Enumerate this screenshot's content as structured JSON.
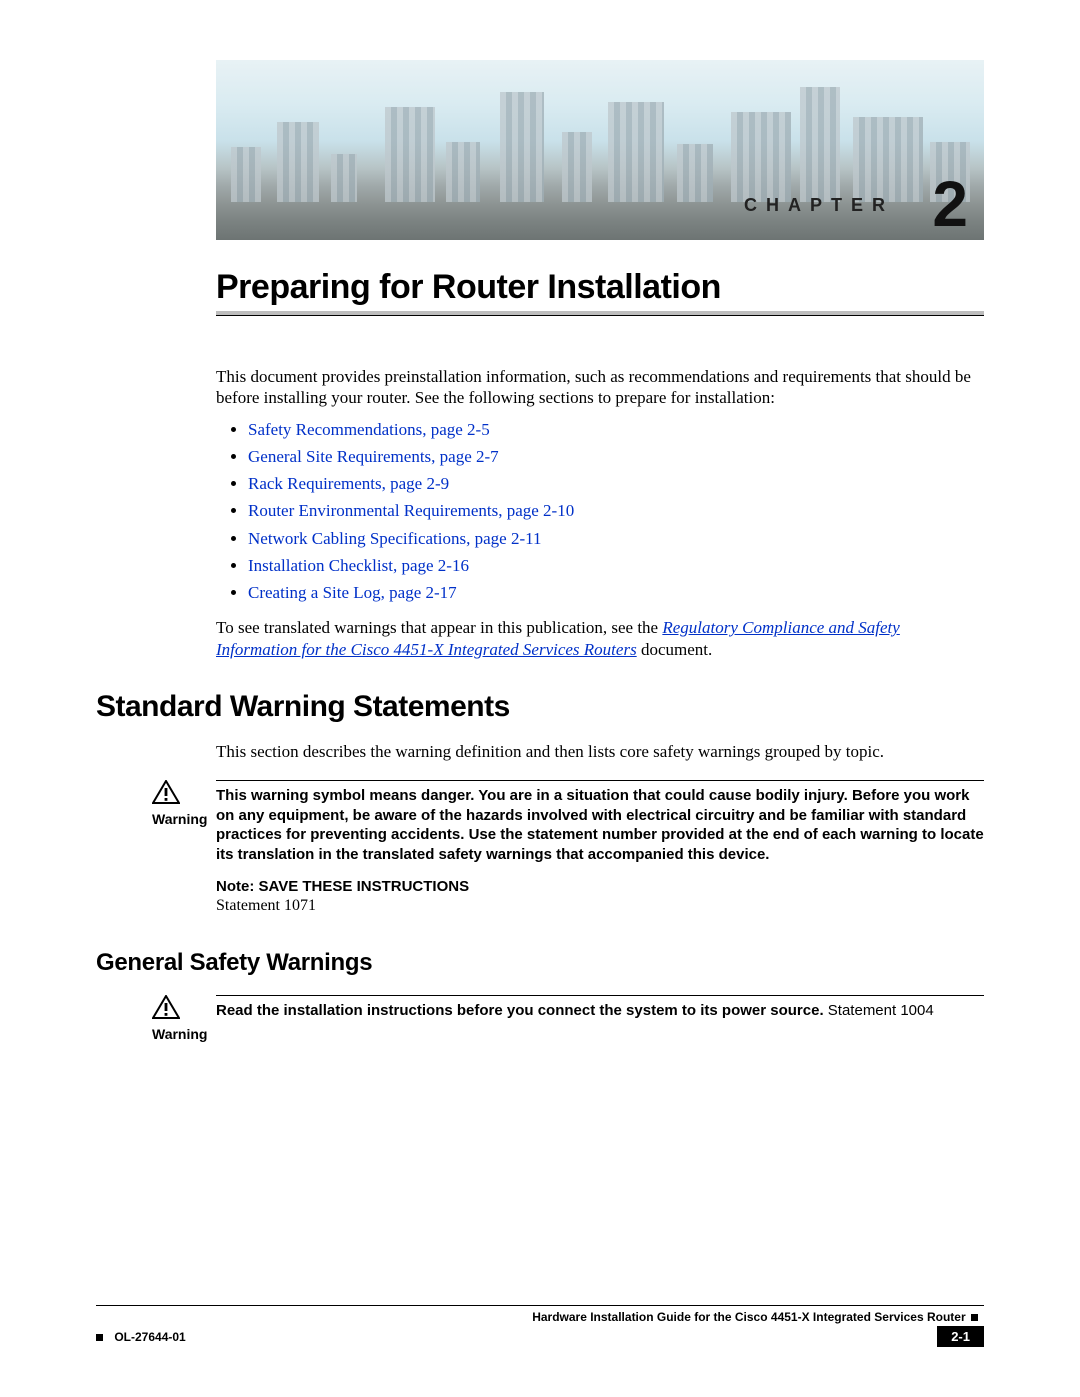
{
  "banner": {
    "chapter_label": "CHAPTER",
    "chapter_number": "2"
  },
  "title": "Preparing for Router Installation",
  "intro": "This document provides preinstallation information, such as recommendations and requirements that should be before installing your router. See the following sections to prepare for installation:",
  "toc": [
    "Safety Recommendations, page 2-5",
    "General Site Requirements, page 2-7",
    "Rack Requirements, page 2-9",
    "Router Environmental Requirements, page 2-10",
    "Network Cabling Specifications, page 2-11",
    "Installation Checklist, page 2-16",
    "Creating a Site Log, page 2-17"
  ],
  "translated_prefix": "To see translated warnings that appear in this publication, see the ",
  "translated_link": "Regulatory Compliance and Safety Information for the Cisco 4451-X Integrated Services Routers",
  "translated_suffix": " document.",
  "section1": {
    "heading": "Standard Warning Statements",
    "lead": "This section describes the warning definition and then lists core safety warnings grouped by topic."
  },
  "warning_label": "Warning",
  "warning1": {
    "text_bold": "This warning symbol means danger. You are in a situation that could cause bodily injury. Before you work on any equipment, be aware of the hazards involved with electrical circuitry and be familiar with standard practices for preventing accidents. Use the statement number provided at the end of each warning to locate its translation in the translated safety warnings that accompanied this device.",
    "note": "Note: SAVE THESE INSTRUCTIONS",
    "statement": "Statement 1071"
  },
  "subsection": "General Safety Warnings",
  "warning2": {
    "text_bold": "Read the installation instructions before you connect the system to its power source.",
    "text_tail": " Statement 1004"
  },
  "footer": {
    "guide": "Hardware Installation Guide for the Cisco 4451-X Integrated Services Router",
    "doc_id": "OL-27644-01",
    "page": "2-1"
  }
}
